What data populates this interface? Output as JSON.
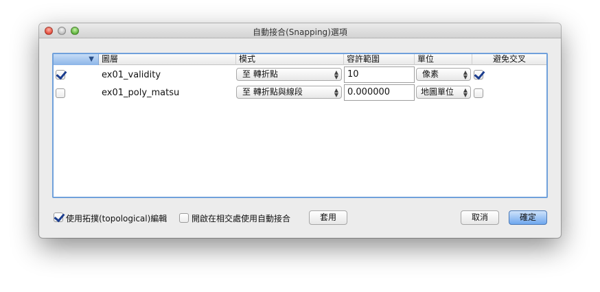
{
  "window": {
    "title": "自動接合(Snapping)選項"
  },
  "table": {
    "columns": [
      {
        "label": ""
      },
      {
        "label": "圖層"
      },
      {
        "label": "模式"
      },
      {
        "label": "容許範圍"
      },
      {
        "label": "單位"
      },
      {
        "label": "避免交叉"
      }
    ],
    "sort_arrow": "▼",
    "rows": [
      {
        "enabled": true,
        "layer": "ex01_validity",
        "mode": "至 轉折點",
        "tolerance": "10",
        "unit": "像素",
        "avoid_intersections": true
      },
      {
        "enabled": false,
        "layer": "ex01_poly_matsu",
        "mode": "至 轉折點與線段",
        "tolerance": "0.000000",
        "unit": "地圖單位",
        "avoid_intersections": false
      }
    ]
  },
  "options": {
    "topological_label": "使用拓撲(topological)編輯",
    "topological_checked": true,
    "intersection_label": "開啟在相交處使用自動接合",
    "intersection_checked": false,
    "apply_label": "套用"
  },
  "buttons": {
    "cancel_label": "取消",
    "ok_label": "確定"
  },
  "icons": {
    "popup": "updown-arrows-icon",
    "check": "checkmark-icon"
  },
  "colors": {
    "accent": "#6fa0db",
    "default_button": "#6fa7ee",
    "checkmark": "#1b3d8f"
  }
}
